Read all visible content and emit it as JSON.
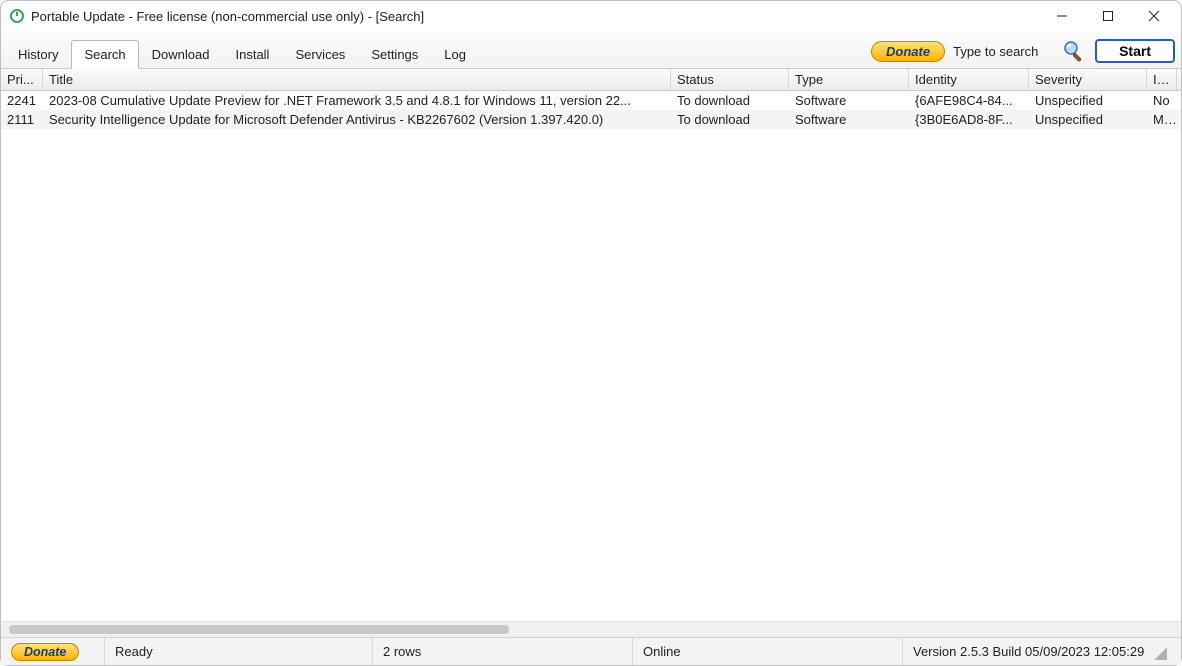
{
  "window": {
    "title": "Portable Update  - Free license (non-commercial use only) - [Search]"
  },
  "tabs": {
    "items": [
      {
        "label": "History",
        "active": false
      },
      {
        "label": "Search",
        "active": true
      },
      {
        "label": "Download",
        "active": false
      },
      {
        "label": "Install",
        "active": false
      },
      {
        "label": "Services",
        "active": false
      },
      {
        "label": "Settings",
        "active": false
      },
      {
        "label": "Log",
        "active": false
      }
    ]
  },
  "toolbar": {
    "donate_label": "Donate",
    "search_placeholder": "Type to search",
    "start_label": "Start"
  },
  "columns": {
    "pri": "Pri...",
    "title": "Title",
    "status": "Status",
    "type": "Type",
    "identity": "Identity",
    "severity": "Severity",
    "installed": "Ins"
  },
  "rows": [
    {
      "pri": "2241",
      "title": "2023-08 Cumulative Update Preview for .NET Framework 3.5 and 4.8.1 for Windows 11, version 22...",
      "status": "To download",
      "type": "Software",
      "identity": "{6AFE98C4-84...",
      "severity": "Unspecified",
      "installed": "No"
    },
    {
      "pri": "2111",
      "title": "Security Intelligence Update for Microsoft Defender Antivirus - KB2267602 (Version 1.397.420.0)",
      "status": "To download",
      "type": "Software",
      "identity": "{3B0E6AD8-8F...",
      "severity": "Unspecified",
      "installed": "Mir"
    }
  ],
  "statusbar": {
    "donate_label": "Donate",
    "ready": "Ready",
    "rows_text": "2 rows",
    "online": "Online",
    "version": "Version 2.5.3 Build 05/09/2023 12:05:29"
  }
}
